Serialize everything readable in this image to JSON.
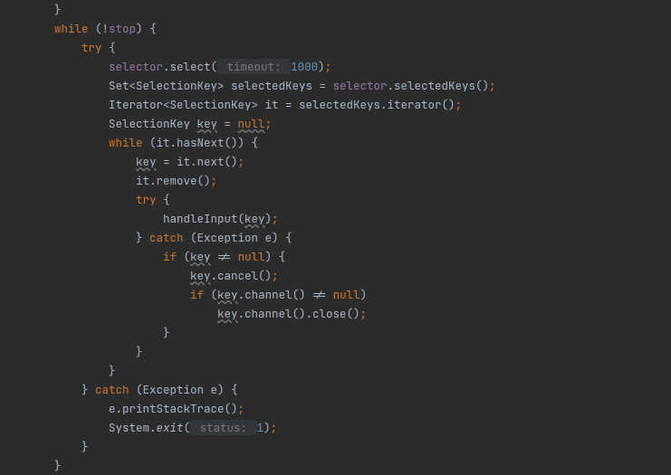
{
  "code": {
    "l1": "        }",
    "l2a": "        ",
    "kw_while1": "while",
    "l2b": " (!",
    "fld_stop": "stop",
    "l2c": ") {",
    "l3a": "            ",
    "kw_try1": "try",
    "l3b": " {",
    "l4a": "                ",
    "fld_selector1": "selector",
    "l4b": ".select(",
    "hint_timeout": " timeout: ",
    "num_1000": "1000",
    "l4c": ")",
    "semi1": ";",
    "l5a": "                Set<SelectionKey> selectedKeys = ",
    "fld_selector2": "selector",
    "l5b": ".selectedKeys()",
    "semi2": ";",
    "l6a": "                Iterator<SelectionKey> it = selectedKeys.iterator()",
    "semi3": ";",
    "l7a": "                SelectionKey ",
    "warn_key1": "key",
    "l7b": " = ",
    "warn_null1": "null",
    "semi4": ";",
    "l8a": "                ",
    "kw_while2": "while",
    "l8b": " (it.hasNext()) {",
    "l9a": "                    ",
    "warn_key2": "key",
    "l9b": " = it.next()",
    "semi5": ";",
    "l10a": "                    it.remove()",
    "semi6": ";",
    "l11a": "                    ",
    "kw_try2": "try",
    "l11b": " {",
    "l12a": "                        handleInput(",
    "warn_key3": "key",
    "l12b": ")",
    "semi7": ";",
    "l13a": "                    } ",
    "kw_catch1": "catch",
    "l13b": " (Exception e) {",
    "l14a": "                        ",
    "kw_if1": "if",
    "l14b": " (",
    "warn_key4": "key",
    "l14c": " != ",
    "kw_null1": "null",
    "l14d": ") {",
    "l15a": "                            ",
    "warn_key5": "key",
    "l15b": ".cancel()",
    "semi8": ";",
    "l16a": "                            ",
    "kw_if2": "if",
    "l16b": " (",
    "warn_key6": "key",
    "l16c": ".channel() != ",
    "kw_null2": "null",
    "l16d": ")",
    "l17a": "                                ",
    "warn_key7": "key",
    "l17b": ".channel().close()",
    "semi9": ";",
    "l18": "                        }",
    "l19": "                    }",
    "l20": "                }",
    "l21a": "            } ",
    "kw_catch2": "catch",
    "l21b": " (Exception e) {",
    "l22a": "                e.printStackTrace()",
    "semi10": ";",
    "l23a": "                System.",
    "stat_exit": "exit",
    "l23b": "(",
    "hint_status": " status: ",
    "num_1": "1",
    "l23c": ")",
    "semi11": ";",
    "l24": "            }",
    "l25": "        }"
  }
}
